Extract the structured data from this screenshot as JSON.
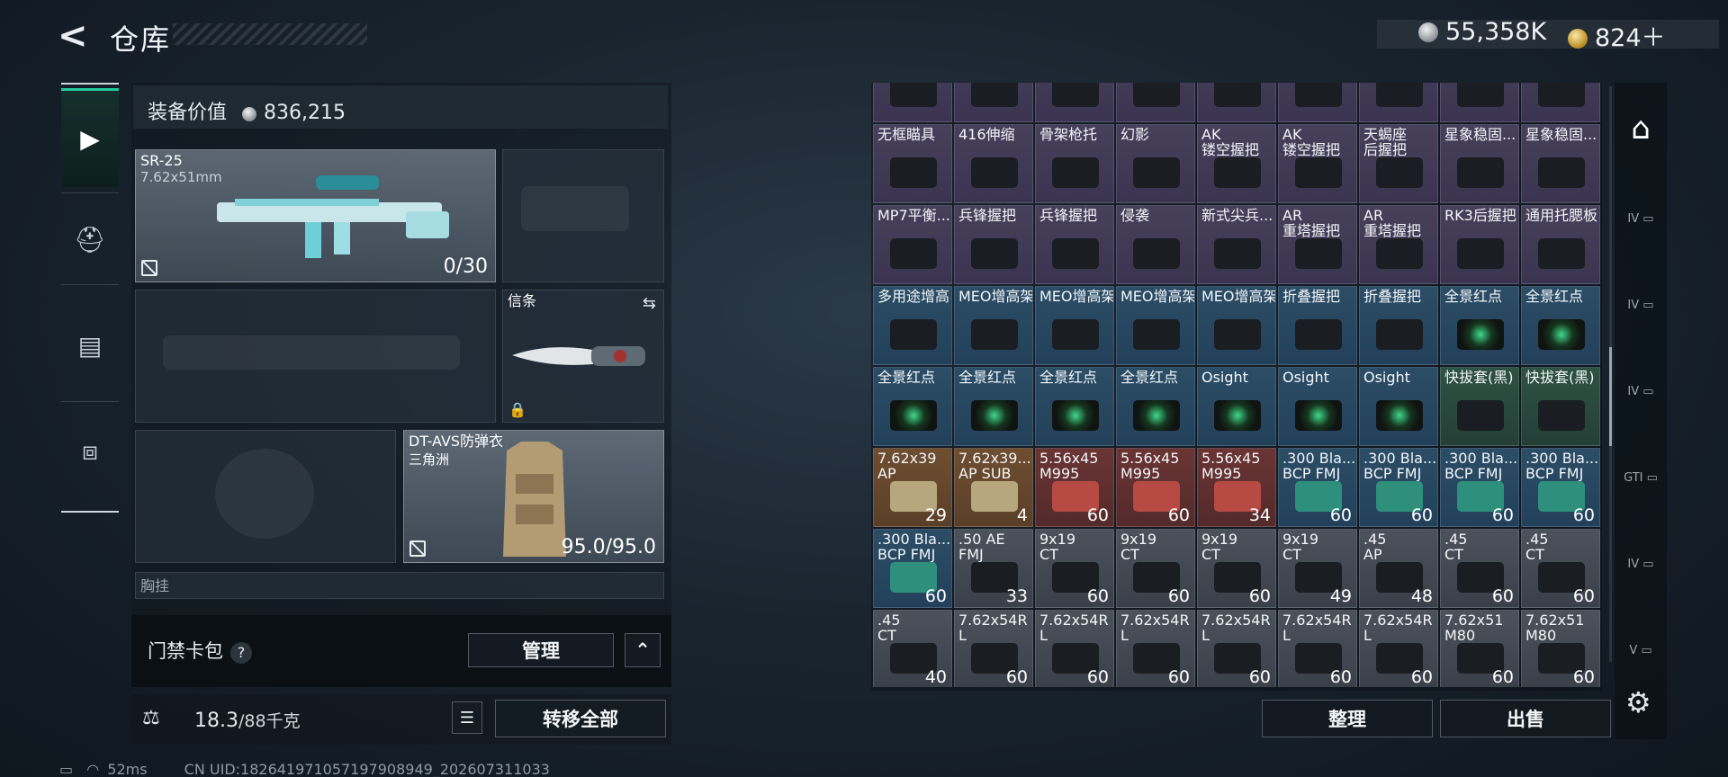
{
  "header": {
    "title": "仓库",
    "silver": "55,358K",
    "gold": "824＋"
  },
  "nav": [
    {
      "icon": "pistol-icon",
      "active": true
    },
    {
      "icon": "helmet-icon",
      "active": false
    },
    {
      "icon": "backpack-icon",
      "active": false
    },
    {
      "icon": "toolbox-icon",
      "active": false
    }
  ],
  "loadout": {
    "value_label": "装备价值",
    "value": "836,215",
    "primary": {
      "name": "SR-25",
      "caliber": "7.62x51mm",
      "ammo": "0/30"
    },
    "melee": {
      "label": "信条"
    },
    "armor": {
      "name": "DT-AVS防弹衣",
      "sub": "三角洲",
      "durability": "95.0/95.0"
    },
    "chest_label": "胸挂"
  },
  "keycard": {
    "label": "门禁卡包",
    "help": "?",
    "manage": "管理"
  },
  "weight": {
    "current": "18.3",
    "max": "/88千克",
    "transfer_all": "转移全部"
  },
  "status": {
    "ping": "52ms",
    "uid": "CN UID:18264197105719790894​9_202607311033"
  },
  "stash": {
    "rows": [
      [
        {
          "n": "",
          "c": "purple"
        },
        {
          "n": "",
          "c": "purple"
        },
        {
          "n": "",
          "c": "purple"
        },
        {
          "n": "",
          "c": "purple"
        },
        {
          "n": "",
          "c": "purple"
        },
        {
          "n": "",
          "c": "purple"
        },
        {
          "n": "",
          "c": "purple"
        },
        {
          "n": "",
          "c": "purple"
        }
      ],
      [
        {
          "n": "无框瞄具",
          "c": "purple"
        },
        {
          "n": "416伸缩",
          "c": "purple"
        },
        {
          "n": "骨架枪托",
          "c": "purple"
        },
        {
          "n": "幻影",
          "c": "purple"
        },
        {
          "n": "AK\n镂空握把",
          "c": "purple"
        },
        {
          "n": "AK\n镂空握把",
          "c": "purple"
        },
        {
          "n": "天蝎座\n后握把",
          "c": "purple"
        },
        {
          "n": "星象稳固...",
          "c": "purple"
        }
      ],
      [
        {
          "n": "MP7平衡...",
          "c": "purple"
        },
        {
          "n": "兵锋握把",
          "c": "purple"
        },
        {
          "n": "兵锋握把",
          "c": "purple"
        },
        {
          "n": "侵袭",
          "c": "purple"
        },
        {
          "n": "新式尖兵...",
          "c": "purple"
        },
        {
          "n": "AR\n重塔握把",
          "c": "purple"
        },
        {
          "n": "AR\n重塔握把",
          "c": "purple"
        },
        {
          "n": "RK3后握把",
          "c": "purple"
        }
      ],
      [
        {
          "n": "多用途增高",
          "c": "blue"
        },
        {
          "n": "MEO增高架",
          "c": "blue"
        },
        {
          "n": "MEO增高架",
          "c": "blue"
        },
        {
          "n": "MEO增高架",
          "c": "blue"
        },
        {
          "n": "MEO增高架",
          "c": "blue"
        },
        {
          "n": "折叠握把",
          "c": "blue"
        },
        {
          "n": "折叠握把",
          "c": "blue"
        },
        {
          "n": "全景红点",
          "c": "blue"
        }
      ],
      [
        {
          "n": "全景红点",
          "c": "blue"
        },
        {
          "n": "全景红点",
          "c": "blue"
        },
        {
          "n": "全景红点",
          "c": "blue"
        },
        {
          "n": "全景红点",
          "c": "blue"
        },
        {
          "n": "Osight",
          "c": "blue"
        },
        {
          "n": "Osight",
          "c": "blue"
        },
        {
          "n": "Osight",
          "c": "blue"
        },
        {
          "n": "快拔套(黑)",
          "c": "green"
        }
      ],
      [
        {
          "n": "7.62x39\nAP",
          "c": "orange",
          "q": "29"
        },
        {
          "n": "7.62x39...\nAP SUB",
          "c": "orange",
          "q": "4"
        },
        {
          "n": "5.56x45\nM995",
          "c": "red",
          "q": "60"
        },
        {
          "n": "5.56x45\nM995",
          "c": "red",
          "q": "60"
        },
        {
          "n": "5.56x45\nM995",
          "c": "red",
          "q": "34"
        },
        {
          "n": ".300 Bla...\nBCP FMJ",
          "c": "blue",
          "q": "60"
        },
        {
          "n": ".300 Bla...\nBCP FMJ",
          "c": "blue",
          "q": "60"
        },
        {
          "n": ".300 Bla...\nBCP FMJ",
          "c": "blue",
          "q": "60"
        }
      ],
      [
        {
          "n": ".300 Bla...\nBCP FMJ",
          "c": "blue",
          "q": "60"
        },
        {
          "n": ".50 AE\nFMJ",
          "c": "gray",
          "q": "33"
        },
        {
          "n": "9x19\nCT",
          "c": "gray",
          "q": "60"
        },
        {
          "n": "9x19\nCT",
          "c": "gray",
          "q": "60"
        },
        {
          "n": "9x19\nCT",
          "c": "gray",
          "q": "60"
        },
        {
          "n": "9x19\nCT",
          "c": "gray",
          "q": "49"
        },
        {
          "n": ".45\nAP",
          "c": "gray",
          "q": "48"
        },
        {
          "n": ".45\nCT",
          "c": "gray",
          "q": "60"
        }
      ],
      [
        {
          "n": ".45\nCT",
          "c": "gray",
          "q": "40"
        },
        {
          "n": "7.62x54R\nL",
          "c": "gray",
          "q": "60"
        },
        {
          "n": "7.62x54R\nL",
          "c": "gray",
          "q": "60"
        },
        {
          "n": "7.62x54R\nL",
          "c": "gray",
          "q": "60"
        },
        {
          "n": "7.62x54R\nL",
          "c": "gray",
          "q": "60"
        },
        {
          "n": "7.62x54R\nL",
          "c": "gray",
          "q": "60"
        },
        {
          "n": "7.62x54R\nL",
          "c": "gray",
          "q": "60"
        },
        {
          "n": "7.62x51\nM80",
          "c": "gray",
          "q": "60"
        }
      ]
    ],
    "extra_col": [
      "",
      "星象稳固...",
      "通用托腮板",
      "全景红点",
      "快拔套(黑)",
      ".300 Bla...\nBCP FMJ",
      ".45\nCT",
      "7.62x51\nM80"
    ],
    "extra_qty": [
      "",
      "",
      "",
      "",
      "",
      "60",
      "60",
      "60"
    ],
    "sort": "整理",
    "sell": "出售"
  },
  "rail": [
    "headquarters-icon",
    "lvl4-weapon-icon",
    "lvl4-weapon-icon",
    "lvl4-weapon-icon",
    "gti-case-icon",
    "lvl4-add-icon",
    "lvl5-case-icon"
  ],
  "rail_labels": [
    "",
    "IV",
    "IV",
    "IV",
    "GTI",
    "IV",
    "V"
  ]
}
